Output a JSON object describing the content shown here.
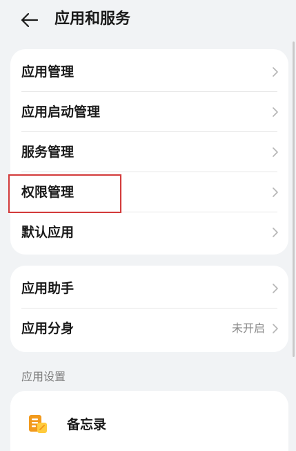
{
  "header": {
    "title": "应用和服务",
    "back_icon": "arrow-left-icon"
  },
  "group1": {
    "items": [
      {
        "label": "应用管理"
      },
      {
        "label": "应用启动管理"
      },
      {
        "label": "服务管理"
      },
      {
        "label": "权限管理",
        "highlighted": true
      },
      {
        "label": "默认应用"
      }
    ]
  },
  "group2": {
    "items": [
      {
        "label": "应用助手",
        "value": ""
      },
      {
        "label": "应用分身",
        "value": "未开启"
      }
    ]
  },
  "app_settings": {
    "section_title": "应用设置",
    "items": [
      {
        "name": "备忘录",
        "icon": "memo-app-icon"
      }
    ]
  },
  "colors": {
    "highlight_border": "#d33a3a",
    "page_background": "#f1f3f5",
    "card_background": "#ffffff",
    "memo_icon_orange": "#f29a1d",
    "memo_icon_yellow": "#ffcb3d"
  }
}
